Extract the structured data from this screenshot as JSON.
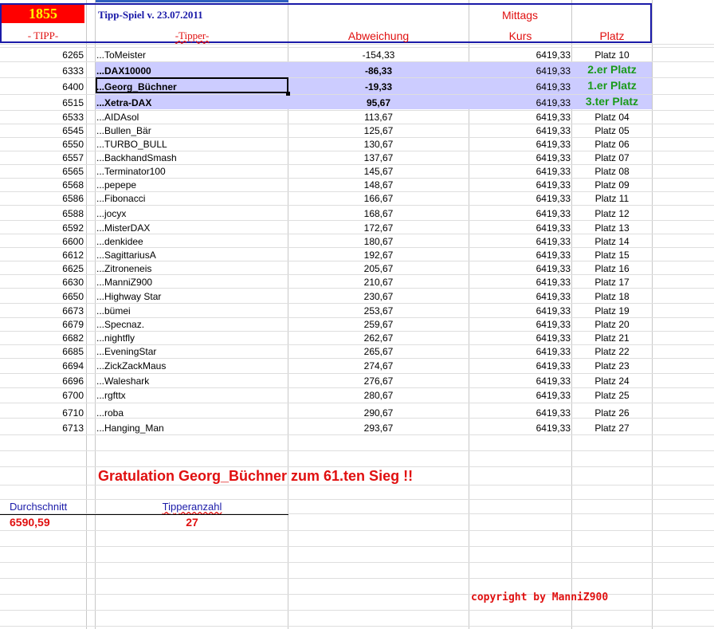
{
  "header": {
    "badge_number": "1855",
    "title": "Tipp-Spiel v. 23.07.2011",
    "session": "Mittags",
    "col_tipp": "- TIPP-",
    "col_tipper": "-Tipper-",
    "col_abweichung": "Abweichung",
    "col_kurs": "Kurs",
    "col_platz": "Platz"
  },
  "rows": [
    {
      "tipp": "6265",
      "tipper": "...ToMeister",
      "abw": "-154,33",
      "kurs": "6419,33",
      "platz": "Platz 10",
      "hl": false,
      "bold": false
    },
    {
      "tipp": "6333",
      "tipper": "...DAX10000",
      "abw": "-86,33",
      "kurs": "6419,33",
      "platz": "2.er Platz",
      "hl": true,
      "bold": true
    },
    {
      "tipp": "6400",
      "tipper": "...Georg_Büchner",
      "abw": "-19,33",
      "kurs": "6419,33",
      "platz": "1.er Platz",
      "hl": true,
      "bold": true
    },
    {
      "tipp": "6515",
      "tipper": "...Xetra-DAX",
      "abw": "95,67",
      "kurs": "6419,33",
      "platz": "3.ter Platz",
      "hl": true,
      "bold": true
    },
    {
      "tipp": "6533",
      "tipper": "...AIDAsol",
      "abw": "113,67",
      "kurs": "6419,33",
      "platz": "Platz 04",
      "hl": false,
      "bold": false
    },
    {
      "tipp": "6545",
      "tipper": "...Bullen_Bär",
      "abw": "125,67",
      "kurs": "6419,33",
      "platz": "Platz 05",
      "hl": false,
      "bold": false
    },
    {
      "tipp": "6550",
      "tipper": "...TURBO_BULL",
      "abw": "130,67",
      "kurs": "6419,33",
      "platz": "Platz 06",
      "hl": false,
      "bold": false
    },
    {
      "tipp": "6557",
      "tipper": "...BackhandSmash",
      "abw": "137,67",
      "kurs": "6419,33",
      "platz": "Platz 07",
      "hl": false,
      "bold": false
    },
    {
      "tipp": "6565",
      "tipper": "...Terminator100",
      "abw": "145,67",
      "kurs": "6419,33",
      "platz": "Platz 08",
      "hl": false,
      "bold": false
    },
    {
      "tipp": "6568",
      "tipper": "...pepepe",
      "abw": "148,67",
      "kurs": "6419,33",
      "platz": "Platz 09",
      "hl": false,
      "bold": false
    },
    {
      "tipp": "6586",
      "tipper": "...Fibonacci",
      "abw": "166,67",
      "kurs": "6419,33",
      "platz": "Platz 11",
      "hl": false,
      "bold": false
    },
    {
      "tipp": "6588",
      "tipper": "...jocyx",
      "abw": "168,67",
      "kurs": "6419,33",
      "platz": "Platz 12",
      "hl": false,
      "bold": false
    },
    {
      "tipp": "6592",
      "tipper": "...MisterDAX",
      "abw": "172,67",
      "kurs": "6419,33",
      "platz": "Platz 13",
      "hl": false,
      "bold": false
    },
    {
      "tipp": "6600",
      "tipper": "...denkidee",
      "abw": "180,67",
      "kurs": "6419,33",
      "platz": "Platz 14",
      "hl": false,
      "bold": false
    },
    {
      "tipp": "6612",
      "tipper": "...SagittariusA",
      "abw": "192,67",
      "kurs": "6419,33",
      "platz": "Platz 15",
      "hl": false,
      "bold": false
    },
    {
      "tipp": "6625",
      "tipper": "...Zitroneneis",
      "abw": "205,67",
      "kurs": "6419,33",
      "platz": "Platz 16",
      "hl": false,
      "bold": false
    },
    {
      "tipp": "6630",
      "tipper": "...ManniZ900",
      "abw": "210,67",
      "kurs": "6419,33",
      "platz": "Platz 17",
      "hl": false,
      "bold": false
    },
    {
      "tipp": "6650",
      "tipper": "...Highway Star",
      "abw": "230,67",
      "kurs": "6419,33",
      "platz": "Platz 18",
      "hl": false,
      "bold": false
    },
    {
      "tipp": "6673",
      "tipper": "...bümei",
      "abw": "253,67",
      "kurs": "6419,33",
      "platz": "Platz 19",
      "hl": false,
      "bold": false
    },
    {
      "tipp": "6679",
      "tipper": "...Specnaz.",
      "abw": "259,67",
      "kurs": "6419,33",
      "platz": "Platz 20",
      "hl": false,
      "bold": false
    },
    {
      "tipp": "6682",
      "tipper": "...nightfly",
      "abw": "262,67",
      "kurs": "6419,33",
      "platz": "Platz 21",
      "hl": false,
      "bold": false
    },
    {
      "tipp": "6685",
      "tipper": "...EveningStar",
      "abw": "265,67",
      "kurs": "6419,33",
      "platz": "Platz 22",
      "hl": false,
      "bold": false
    },
    {
      "tipp": "6694",
      "tipper": "...ZickZackMaus",
      "abw": "274,67",
      "kurs": "6419,33",
      "platz": "Platz 23",
      "hl": false,
      "bold": false
    },
    {
      "tipp": "6696",
      "tipper": "...Waleshark",
      "abw": "276,67",
      "kurs": "6419,33",
      "platz": "Platz 24",
      "hl": false,
      "bold": false
    },
    {
      "tipp": "6700",
      "tipper": "...rgfttx",
      "abw": "280,67",
      "kurs": "6419,33",
      "platz": "Platz 25",
      "hl": false,
      "bold": false
    },
    {
      "tipp": "6710",
      "tipper": "...roba",
      "abw": "290,67",
      "kurs": "6419,33",
      "platz": "Platz 26",
      "hl": false,
      "bold": false
    },
    {
      "tipp": "6713",
      "tipper": "...Hanging_Man",
      "abw": "293,67",
      "kurs": "6419,33",
      "platz": "Platz 27",
      "hl": false,
      "bold": false
    }
  ],
  "gratulation": "Gratulation  Georg_Büchner zum  61.ten Sieg !!",
  "summary": {
    "durchschnitt_label": "Durchschnitt",
    "durchschnitt_value": "6590,59",
    "tipperanzahl_label": "Tipperanzahl",
    "tipperanzahl_value": "27"
  },
  "copyright": "copyright by ManniZ900",
  "colors": {
    "header_blue": "#1a1aa8",
    "red": "#e01010",
    "green": "#1a9a1a",
    "highlight": "#ccccff",
    "badge_bg": "#ff0000",
    "badge_text": "#ffff00"
  }
}
